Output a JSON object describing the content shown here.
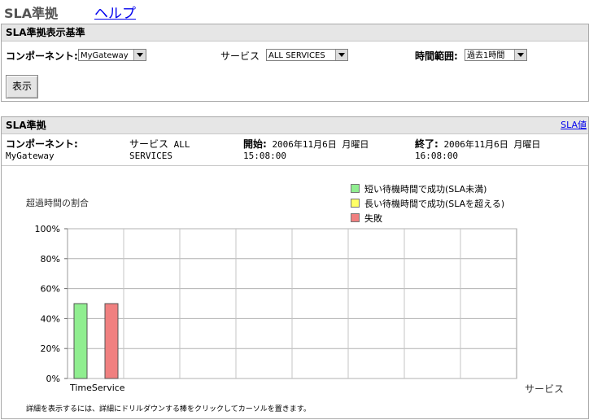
{
  "header": {
    "title": "SLA準拠",
    "help_link": "ヘルプ"
  },
  "criteria_panel": {
    "title": "SLA準拠表示基準",
    "component_label": "コンポーネント:",
    "component_value": "MyGateway",
    "service_label": "サービス",
    "service_value": "ALL SERVICES",
    "time_range_label": "時間範囲:",
    "time_range_value": "過去1時間",
    "display_button": "表示"
  },
  "sla_panel": {
    "title": "SLA準拠",
    "sla_values_link": "SLA値",
    "component_label": "コンポーネント:",
    "component_value": "MyGateway",
    "service_label": "サービス",
    "service_value_1": "ALL",
    "service_value_2": "SERVICES",
    "start_label": "開始:",
    "start_value_1": "2006年11月6日 月曜日",
    "start_value_2": "15:08:00",
    "end_label": "終了:",
    "end_value_1": "2006年11月6日 月曜日",
    "end_value_2": "16:08:00",
    "footnote": "詳細を表示するには、詳細にドリルダウンする棒をクリックしてカーソルを置きます。"
  },
  "chart_data": {
    "type": "bar",
    "ylabel": "超過時間の割合",
    "xlabel": "サービス",
    "ylim": [
      0,
      100
    ],
    "yticks": [
      "0%",
      "20%",
      "40%",
      "60%",
      "80%",
      "100%"
    ],
    "categories": [
      "TimeService"
    ],
    "legend_position": "top-right",
    "grid": true,
    "series": [
      {
        "name": "短い待機時間で成功(SLA未満)",
        "color": "#90ee90",
        "values": [
          50
        ]
      },
      {
        "name": "長い待機時間で成功(SLAを超える)",
        "color": "#ffff66",
        "values": [
          0
        ]
      },
      {
        "name": "失敗",
        "color": "#f08080",
        "values": [
          50
        ]
      }
    ]
  }
}
